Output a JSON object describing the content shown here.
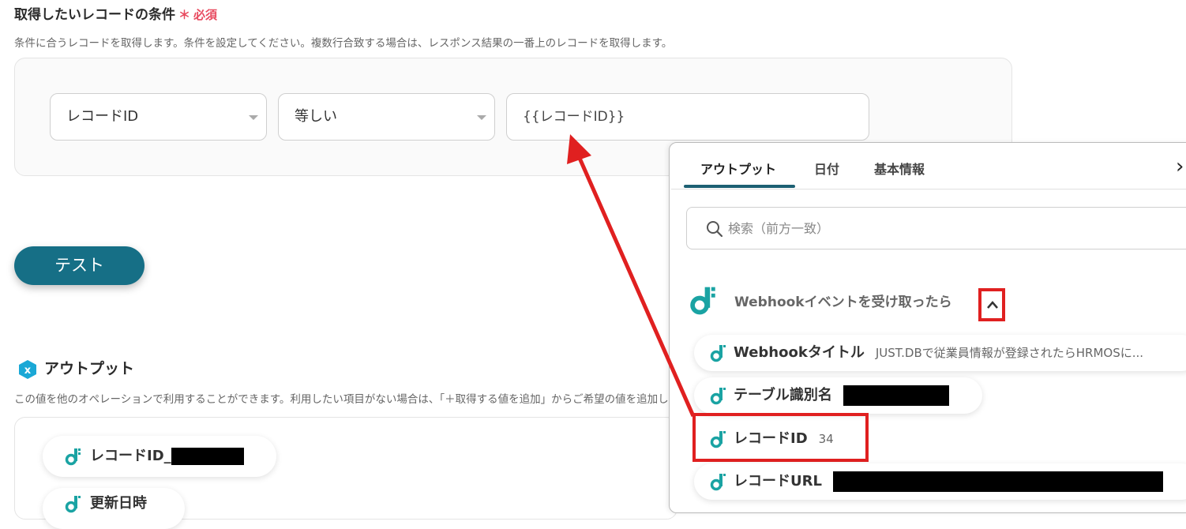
{
  "section": {
    "title": "取得したいレコードの条件",
    "required_mark": "＊",
    "required_label": "必須",
    "description": "条件に合うレコードを取得します。条件を設定してください。複数行合致する場合は、レスポンス結果の一番上のレコードを取得します。"
  },
  "condition": {
    "field_select": "レコードID",
    "operator_select": "等しい",
    "value_input": "{{レコードID}}"
  },
  "test_button": "テスト",
  "output": {
    "title": "アウトプット",
    "description": "この値を他のオペレーションで利用することができます。利用したい項目がない場合は、「＋取得する値を追加」からご希望の値を追加してください。",
    "items": [
      {
        "label": "レコードID_"
      },
      {
        "label": "更新日時"
      }
    ]
  },
  "panel": {
    "tabs": [
      {
        "label": "アウトプット"
      },
      {
        "label": "日付"
      },
      {
        "label": "基本情報"
      }
    ],
    "close_glyph": "›",
    "search_placeholder": "検索（前方一致）",
    "group_title": "Webhookイベントを受け取ったら",
    "items": [
      {
        "label": "Webhookタイトル",
        "value": "JUST.DBで従業員情報が登録されたらHRMOSに..."
      },
      {
        "label": "テーブル識別名",
        "value": ""
      },
      {
        "label": "レコードID",
        "value": "34"
      },
      {
        "label": "レコードURL",
        "value": ""
      }
    ]
  },
  "colors": {
    "accent": "#166f86",
    "required": "#e84a5f",
    "highlight": "#e02020",
    "brand_icon": "#1aa3a3"
  }
}
